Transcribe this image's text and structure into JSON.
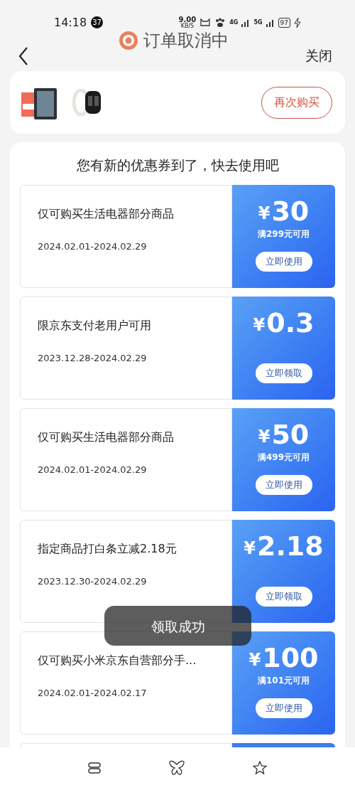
{
  "status_bar": {
    "time": "14:18",
    "notification_count": "37",
    "speed": "9.00",
    "speed_unit": "KB/S",
    "network_1": "4G",
    "network_2": "5G",
    "battery": "97"
  },
  "banner": {
    "text": "订单取消中"
  },
  "header": {
    "close": "关闭"
  },
  "order": {
    "button": "再次购买"
  },
  "coupons_title": "您有新的优惠券到了，快去使用吧",
  "coupons": [
    {
      "title": "仅可购买生活电器部分商品",
      "dates": "2024.02.01-2024.02.29",
      "currency": "¥",
      "amount": "30",
      "condition": "满299元可用",
      "button": "立即使用"
    },
    {
      "title": "限京东支付老用户可用",
      "dates": "2023.12.28-2024.02.29",
      "currency": "¥",
      "amount": "0.3",
      "button": "立即领取"
    },
    {
      "title": "仅可购买生活电器部分商品",
      "dates": "2024.02.01-2024.02.29",
      "currency": "¥",
      "amount": "50",
      "condition": "满499元可用",
      "button": "立即使用"
    },
    {
      "title": "指定商品打白条立减2.18元",
      "dates": "2023.12.30-2024.02.29",
      "currency": "¥",
      "amount": "2.18",
      "button": "立即领取"
    },
    {
      "title": "仅可购买小米京东自营部分手...",
      "dates": "2024.02.01-2024.02.17",
      "currency": "¥",
      "amount": "100",
      "condition": "满101元可用",
      "button": "立即使用"
    }
  ],
  "toast": "领取成功"
}
